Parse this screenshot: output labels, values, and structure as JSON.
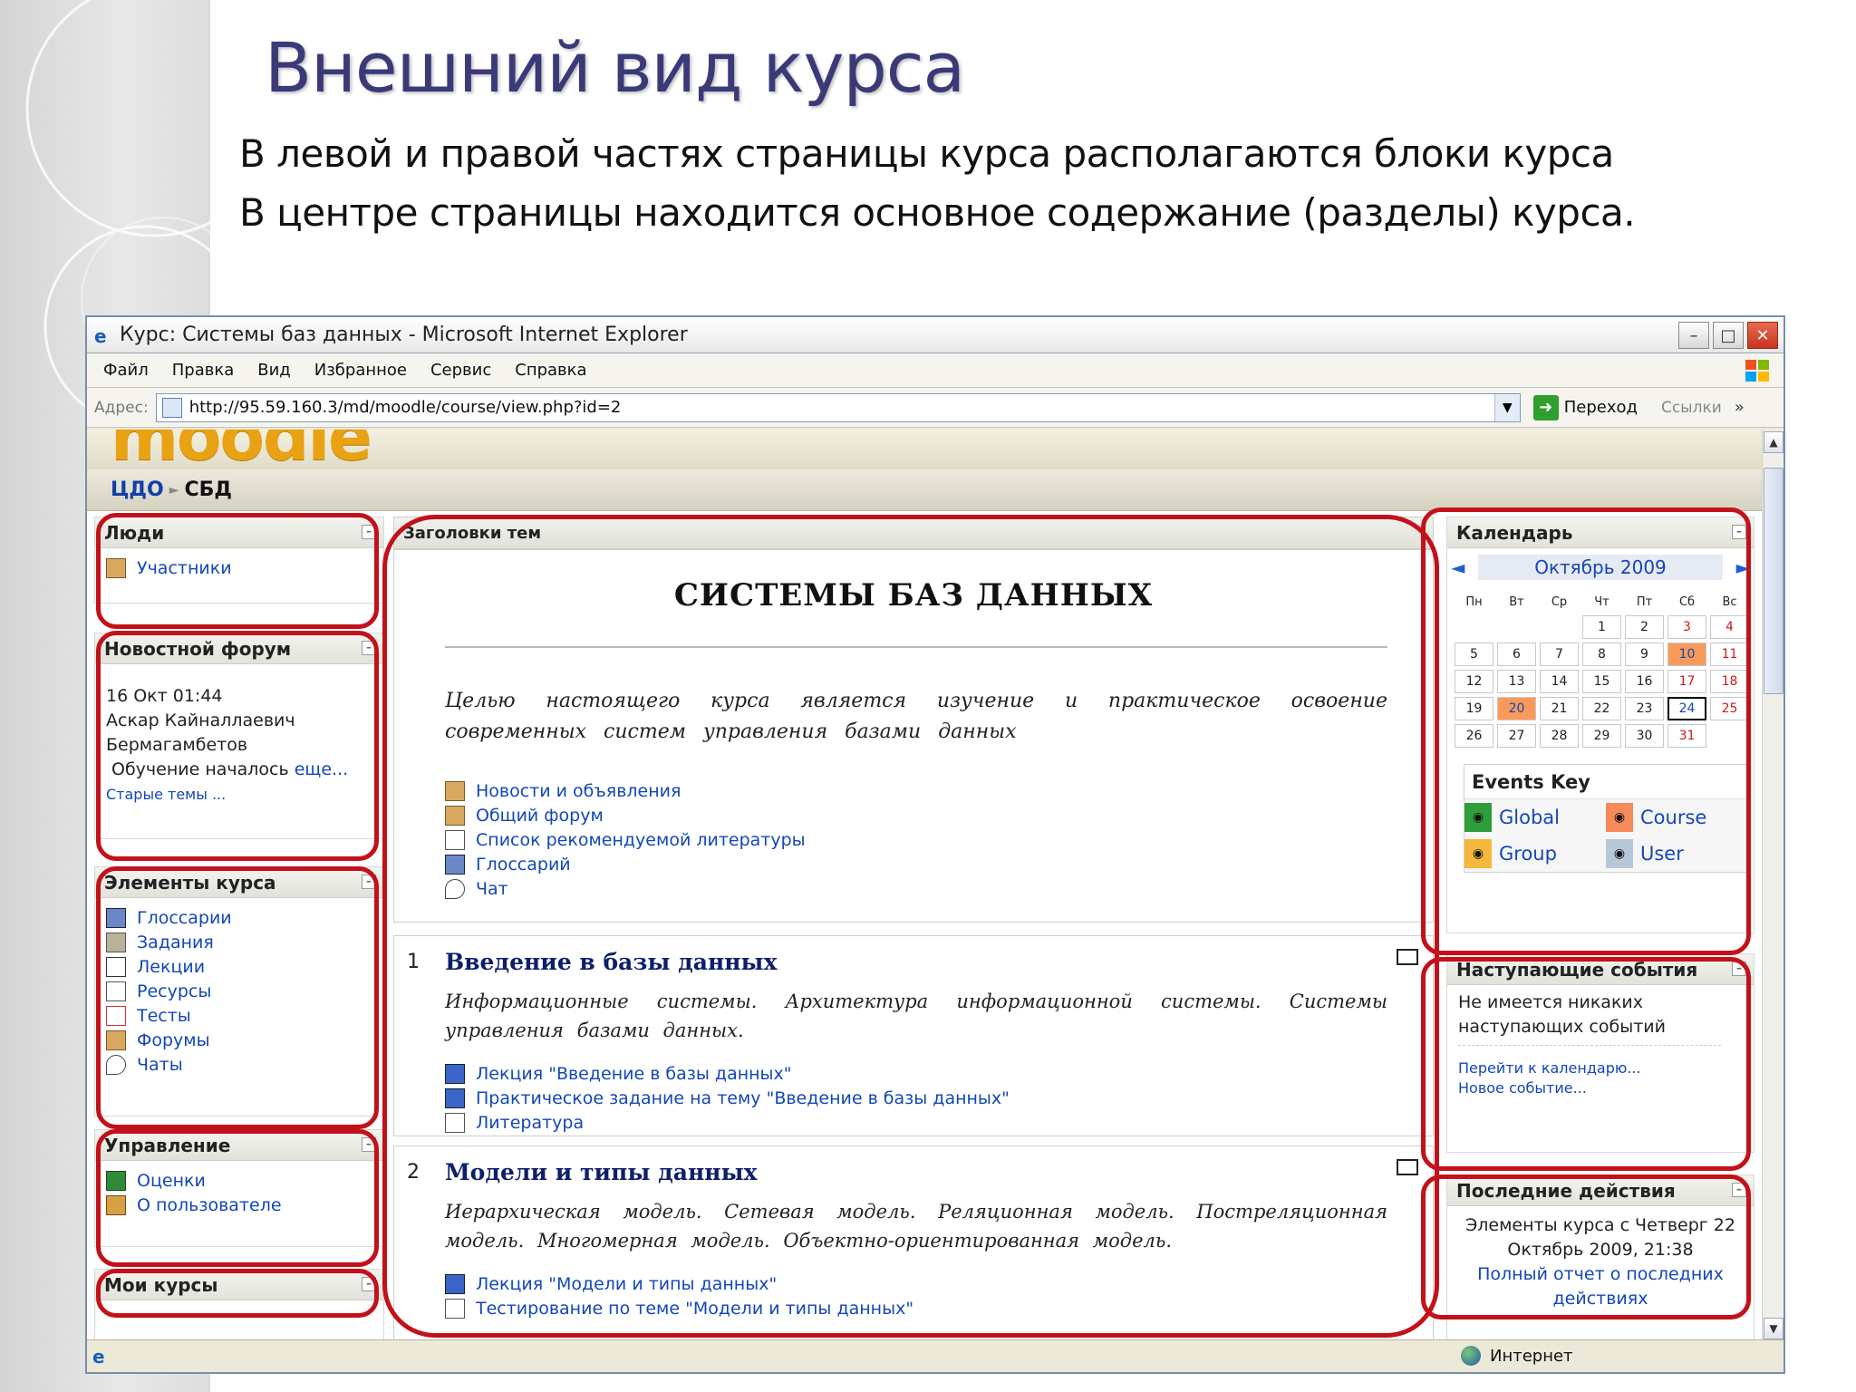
{
  "slide": {
    "title": "Внешний вид курса",
    "line1": "В левой и правой частях страницы курса располагаются блоки курса",
    "line2": "В центре страницы находится основное содержание (разделы) курса."
  },
  "window": {
    "title": "Курс: Системы баз данных - Microsoft Internet Explorer",
    "menu": [
      "Файл",
      "Правка",
      "Вид",
      "Избранное",
      "Сервис",
      "Справка"
    ],
    "address_label": "Адрес:",
    "url": "http://95.59.160.3/md/moodle/course/view.php?id=2",
    "go_label": "Переход",
    "links_label": "Ссылки",
    "links_more": "»",
    "status_zone": "Интернет"
  },
  "moodle": {
    "logo": "moodle",
    "breadcrumb": {
      "home": "ЦДО",
      "separator": "►",
      "current": "СБД"
    }
  },
  "left_blocks": {
    "people": {
      "title": "Люди",
      "items": [
        "Участники"
      ]
    },
    "news": {
      "title": "Новостной форум",
      "date": "16 Окт 01:44",
      "author_line1": "Аскар Кайналлаевич",
      "author_line2": "Бермагамбетов",
      "post": "Обучение началось",
      "more": "еще...",
      "older": "Старые темы ..."
    },
    "activities": {
      "title": "Элементы курса",
      "items": [
        "Глоссарии",
        "Задания",
        "Лекции",
        "Ресурсы",
        "Тесты",
        "Форумы",
        "Чаты"
      ]
    },
    "admin": {
      "title": "Управление",
      "items": [
        "Оценки",
        "О пользователе"
      ]
    },
    "my_courses": {
      "title": "Мои курсы"
    }
  },
  "center": {
    "header": "Заголовки тем",
    "course_title": "СИСТЕМЫ БАЗ ДАННЫХ",
    "summary": "Целью настоящего курса является изучение и практическое освоение современных систем управления базами данных",
    "topic0_links": [
      "Новости и объявления",
      "Общий форум",
      "Список рекомендуемой литературы",
      "Глоссарий",
      "Чат"
    ],
    "topics": [
      {
        "num": "1",
        "title": "Введение в базы данных",
        "desc": "Информационные системы. Архитектура информационной системы. Системы управления базами данных.",
        "links": [
          "Лекция \"Введение в базы данных\"",
          "Практическое задание на тему \"Введение в базы данных\"",
          "Литература"
        ]
      },
      {
        "num": "2",
        "title": "Модели и типы данных",
        "desc": "Иерархическая модель. Сетевая модель. Реляционная модель. Постреляционная модель. Многомерная модель. Объектно-ориентированная модель.",
        "links": [
          "Лекция \"Модели и типы данных\"",
          "Тестирование по теме \"Модели и типы данных\""
        ]
      }
    ]
  },
  "right_blocks": {
    "calendar": {
      "title": "Календарь",
      "month": "Октябрь 2009",
      "weekdays": [
        "Пн",
        "Вт",
        "Ср",
        "Чт",
        "Пт",
        "Сб",
        "Вс"
      ],
      "weeks": [
        [
          "",
          "",
          "",
          "1",
          "2",
          "3",
          "4"
        ],
        [
          "5",
          "6",
          "7",
          "8",
          "9",
          "10",
          "11"
        ],
        [
          "12",
          "13",
          "14",
          "15",
          "16",
          "17",
          "18"
        ],
        [
          "19",
          "20",
          "21",
          "22",
          "23",
          "24",
          "25"
        ],
        [
          "26",
          "27",
          "28",
          "29",
          "30",
          "31",
          ""
        ]
      ],
      "event_days": [
        "10",
        "20"
      ],
      "today": "24",
      "events_key_title": "Events Key",
      "events_key": [
        {
          "label": "Global",
          "color": "#2e9e3a"
        },
        {
          "label": "Course",
          "color": "#f58a5a"
        },
        {
          "label": "Group",
          "color": "#f5b83a"
        },
        {
          "label": "User",
          "color": "#b7c7d8"
        }
      ]
    },
    "upcoming": {
      "title": "Наступающие события",
      "text": "Не имеется никаких наступающих событий",
      "goto_calendar": "Перейти к календарю...",
      "new_event": "Новое событие..."
    },
    "recent": {
      "title": "Последние действия",
      "text": "Элементы курса с Четверг 22 Октябрь 2009, 21:38",
      "full_report": "Полный отчет о последних действиях"
    }
  },
  "colors": {
    "annotation_red": "#c3111a",
    "link_blue": "#1347b8",
    "title_blue": "#3a3a78"
  }
}
